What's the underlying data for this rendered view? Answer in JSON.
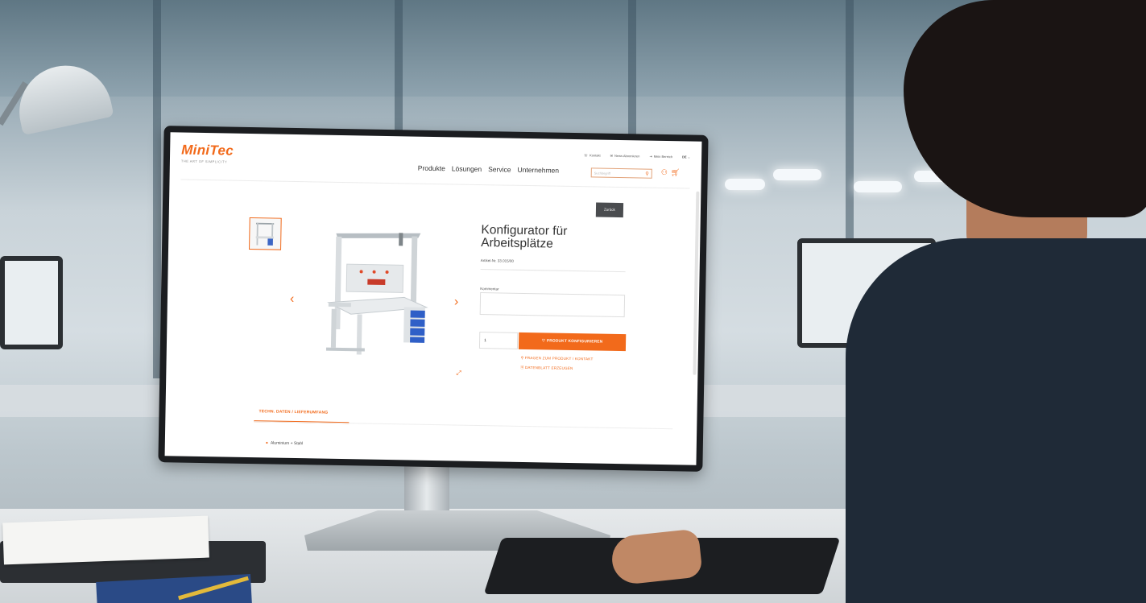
{
  "scene": {
    "description_items": [
      "office-background",
      "desktop-monitor",
      "person-typing",
      "keyboard",
      "desk-items"
    ]
  },
  "website": {
    "brand": {
      "name": "MiniTec",
      "tagline": "THE ART OF SIMPLICITY",
      "accent": "#f26a1b"
    },
    "topbar": {
      "kontakt": "Kontakt",
      "newsletter": "News Abonnieren",
      "login": "Mein Bereich",
      "lang": "DE"
    },
    "nav": [
      "Produkte",
      "Lösungen",
      "Service",
      "Unternehmen"
    ],
    "search": {
      "placeholder": "Suchbegriff"
    },
    "back_button": "Zurück",
    "product": {
      "title_line1": "Konfigurator für",
      "title_line2": "Arbeitsplätze",
      "article_nr": "Artikel-Nr. 33.015/00",
      "comment_label": "Kommentar",
      "quantity": "1",
      "configure_button": "PRODUKT KONFIGURIEREN",
      "link_questions": "FRAGEN ZUM PRODUKT / KONTAKT",
      "link_datasheet": "DATENBLATT ERZEUGEN"
    },
    "tabs": {
      "tech": "TECHN. DATEN / LIEFERUMFANG"
    },
    "features": [
      "Aluminium + Stahl"
    ],
    "icons": {
      "prev": "chevron-left-icon",
      "next": "chevron-right-icon",
      "expand": "expand-icon",
      "search": "search-icon",
      "cart": "cart-icon"
    }
  }
}
